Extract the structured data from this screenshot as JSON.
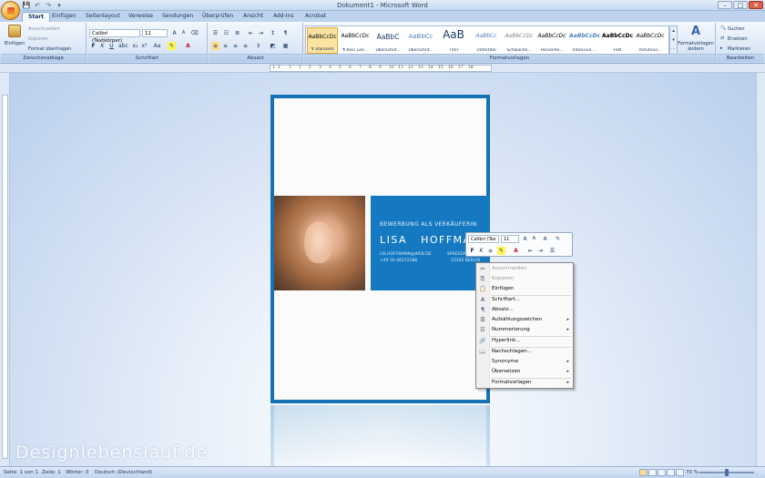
{
  "window": {
    "title": "Dokument1 - Microsoft Word"
  },
  "quick_access": [
    "💾",
    "↶",
    "↷",
    "▾"
  ],
  "window_controls": {
    "minimize": "–",
    "maximize": "□",
    "close": "✕"
  },
  "tabs": [
    "Start",
    "Einfügen",
    "Seitenlayout",
    "Verweise",
    "Sendungen",
    "Überprüfen",
    "Ansicht",
    "Add-Ins",
    "Acrobat"
  ],
  "ribbon": {
    "clipboard": {
      "paste": "Einfügen",
      "cut": "Ausschneiden",
      "copy": "Kopieren",
      "format_painter": "Format übertragen",
      "label": "Zwischenablage"
    },
    "font": {
      "font_name": "Calibri (Textkörper)",
      "font_size": "11",
      "bold": "F",
      "italic": "K",
      "underline": "U",
      "label": "Schriftart"
    },
    "paragraph": {
      "label": "Absatz"
    },
    "styles": {
      "label": "Formatvorlagen",
      "items": [
        {
          "preview": "AaBbCcDc",
          "name": "¶ Standard"
        },
        {
          "preview": "AaBbCcDc",
          "name": "¶ Kein Lee..."
        },
        {
          "preview": "AaBbC",
          "name": "Überschrif..."
        },
        {
          "preview": "AaBbCc",
          "name": "Überschrif..."
        },
        {
          "preview": "AaB",
          "name": "Titel"
        },
        {
          "preview": "AaBbCc",
          "name": "Untertitel"
        },
        {
          "preview": "AaBbCcDc",
          "name": "Schwache..."
        },
        {
          "preview": "AaBbCcDc",
          "name": "Hervorhe..."
        },
        {
          "preview": "AaBbCcDc",
          "name": "Intensive ..."
        },
        {
          "preview": "AaBbCcDc",
          "name": "Fett"
        },
        {
          "preview": "AaBbCcDc",
          "name": "Anführun..."
        }
      ],
      "change_styles": "Formatvorlagen ändern"
    },
    "editing": {
      "label": "Bearbeiten",
      "find": "Suchen",
      "replace": "Ersetzen",
      "select": "Markieren"
    }
  },
  "ruler": {
    "numbers": [
      "1",
      "2",
      "1",
      "1",
      "2",
      "3",
      "4",
      "5",
      "6",
      "7",
      "8",
      "9",
      "10",
      "11",
      "12",
      "13",
      "14",
      "15",
      "16",
      "17",
      "18"
    ]
  },
  "document": {
    "job_title": "BEWERBUNG ALS VERKÄUFERIN",
    "first_name": "LISA",
    "last_name": "HOFFMANN",
    "email": "LIS.HOFFMANN@WEB.DE",
    "phone": "+49 30 46372188",
    "street": "SPREEDAMM",
    "city": "15202 BERLIN"
  },
  "mini_toolbar": {
    "font": "Calibri (Tex",
    "size": "11"
  },
  "context_menu": [
    {
      "label": "Ausschneiden",
      "icon": "✂",
      "disabled": true,
      "submenu": false
    },
    {
      "label": "Kopieren",
      "icon": "⎘",
      "disabled": true,
      "submenu": false
    },
    {
      "label": "Einfügen",
      "icon": "📋",
      "disabled": false,
      "submenu": false
    },
    {
      "label": "Schriftart...",
      "icon": "A",
      "disabled": false,
      "submenu": false
    },
    {
      "label": "Absatz...",
      "icon": "¶",
      "disabled": false,
      "submenu": false
    },
    {
      "label": "Aufzählungszeichen",
      "icon": "☰",
      "disabled": false,
      "submenu": true
    },
    {
      "label": "Nummerierung",
      "icon": "☷",
      "disabled": false,
      "submenu": true
    },
    {
      "label": "Hyperlink...",
      "icon": "🔗",
      "disabled": false,
      "submenu": false
    },
    {
      "label": "Nachschlagen...",
      "icon": "📖",
      "disabled": false,
      "submenu": false
    },
    {
      "label": "Synonyme",
      "icon": "",
      "disabled": false,
      "submenu": true
    },
    {
      "label": "Übersetzen",
      "icon": "",
      "disabled": false,
      "submenu": true
    },
    {
      "label": "Formatvorlagen",
      "icon": "",
      "disabled": false,
      "submenu": true
    }
  ],
  "status": {
    "page": "Seite: 1 von 1",
    "line": "Zeile: 1",
    "words": "Wörter: 0",
    "language": "Deutsch (Deutschland)",
    "zoom": "70 %"
  },
  "watermark": "Designlebenslauf.de"
}
